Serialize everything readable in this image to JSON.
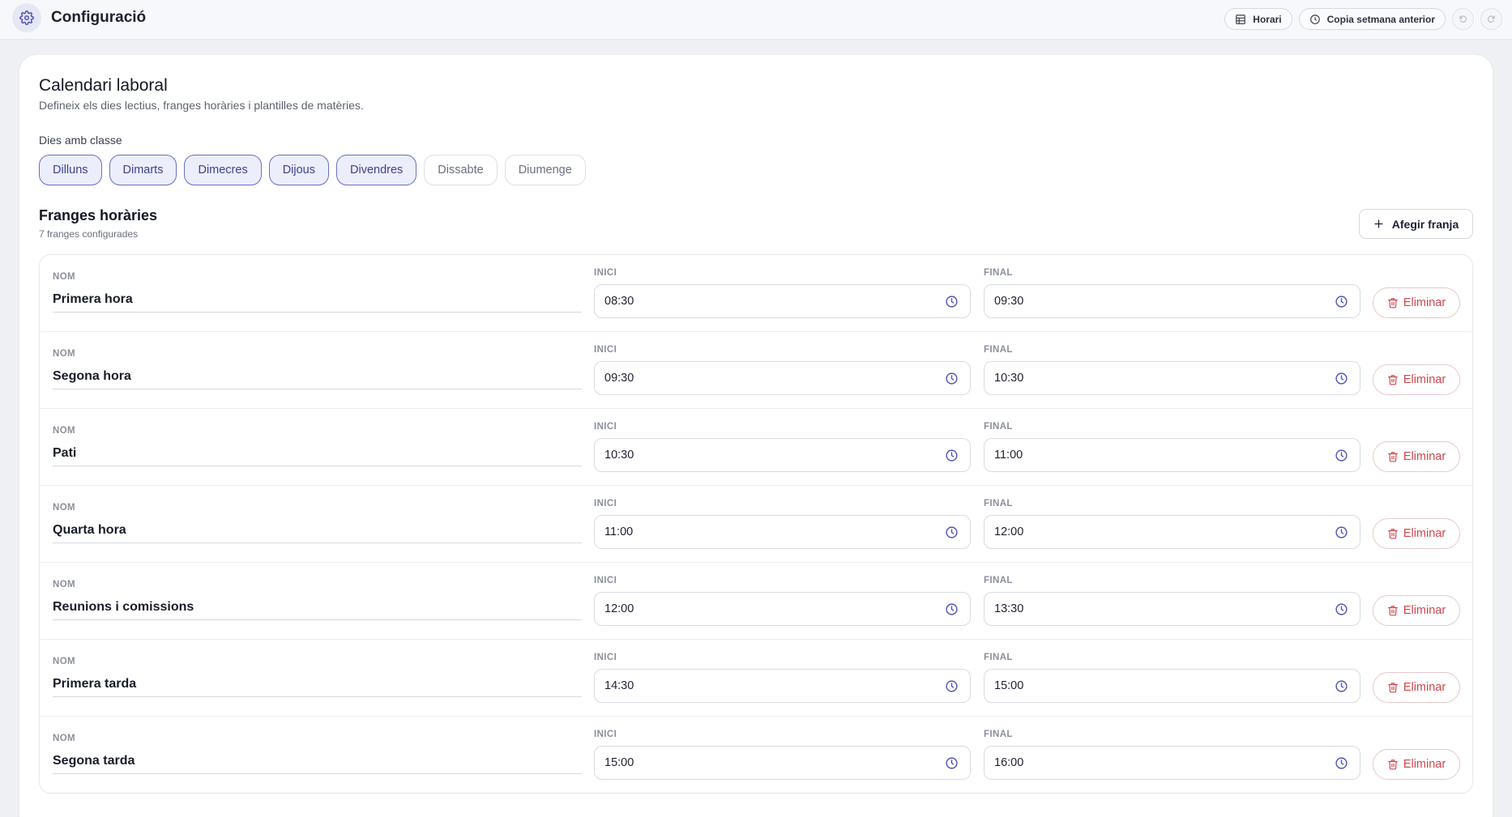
{
  "header": {
    "title": "Configuració",
    "schedule_button": "Horari",
    "copy_week_button": "Copia setmana anterior",
    "icons": [
      "gear-icon",
      "grid-icon",
      "clock-icon",
      "undo-icon",
      "redo-icon"
    ]
  },
  "calendar": {
    "title": "Calendari laboral",
    "subtitle": "Defineix els dies lectius, franges horàries i plantilles de matèries.",
    "days_label": "Dies amb classe",
    "days": [
      {
        "label": "Dilluns",
        "active": true
      },
      {
        "label": "Dimarts",
        "active": true
      },
      {
        "label": "Dimecres",
        "active": true
      },
      {
        "label": "Dijous",
        "active": true
      },
      {
        "label": "Divendres",
        "active": true
      },
      {
        "label": "Dissabte",
        "active": false
      },
      {
        "label": "Diumenge",
        "active": false
      }
    ]
  },
  "slots": {
    "title": "Franges horàries",
    "count": "7 franges configurades",
    "add_button": "Afegir franja",
    "name_label": "NOM",
    "start_label": "INICI",
    "end_label": "FINAL",
    "delete_label": "Eliminar",
    "items": [
      {
        "name": "Primera hora",
        "start": "08:30",
        "end": "09:30"
      },
      {
        "name": "Segona hora",
        "start": "09:30",
        "end": "10:30"
      },
      {
        "name": "Pati",
        "start": "10:30",
        "end": "11:00"
      },
      {
        "name": "Quarta hora",
        "start": "11:00",
        "end": "12:00"
      },
      {
        "name": "Reunions i comissions",
        "start": "12:00",
        "end": "13:30"
      },
      {
        "name": "Primera tarda",
        "start": "14:30",
        "end": "15:00"
      },
      {
        "name": "Segona tarda",
        "start": "15:00",
        "end": "16:00"
      }
    ]
  },
  "colors": {
    "accent": "#4f54b8",
    "active_chip_bg": "#eceefb",
    "danger": "#d0464c",
    "page_bg": "#eef0f4"
  }
}
